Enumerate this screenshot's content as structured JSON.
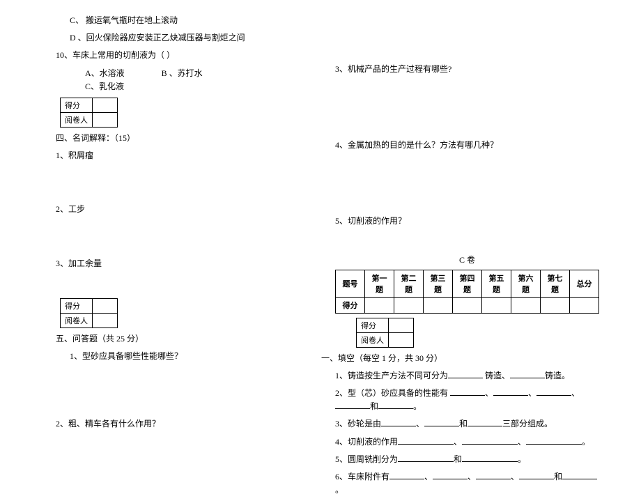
{
  "left": {
    "opt_c": "C、 搬运氧气瓶时在地上滚动",
    "opt_d": "D 、回火保险器应安装正乙炔减压器与割炬之间",
    "q10": "10、车床上常用的切削液为（        ）",
    "q10_opts": {
      "a": "A、水溶液",
      "b": "B 、苏打水",
      "c": "C、乳化液"
    },
    "mini": {
      "score": "得分",
      "marker": "阅卷人"
    },
    "sec4_title": "四、名词解释：（15）",
    "sec4_q1": "1、积屑瘤",
    "sec4_q2": "2、工步",
    "sec4_q3": "3、加工余量",
    "sec5_title": "五、问答题（共 25 分）",
    "sec5_q1": "1、型砂应具备哪些性能哪些？",
    "sec5_q2": "2、粗、精车各有什么作用？"
  },
  "right": {
    "q3": "3、机械产品的生产过程有哪些?",
    "q4": "4、金属加热的目的是什么？方法有哪几种？",
    "q5": "5、切削液的作用？",
    "paper_label": "C 卷",
    "score_header": [
      "题号",
      "第一题",
      "第二题",
      "第三题",
      "第四题",
      "第五题",
      "第六题",
      "第七题",
      "总分"
    ],
    "score_row2_label": "得分",
    "mini": {
      "score": "得分",
      "marker": "阅卷人"
    },
    "sec1_title": "一、填空（每空 1 分，共 30 分）",
    "fill": {
      "q1_a": "1、铸造按生产方法不同可分为",
      "q1_b": " 铸造、",
      "q1_c": "铸造。",
      "q2_a": "2、型（芯）砂应具备的性能有 ",
      "q2_suffix": "和",
      "q2_end": "。",
      "q3_a": "3、砂轮是由",
      "q3_b": "和",
      "q3_c": "三部分组成。",
      "q4_a": "4、切削液的作用",
      "q4_end": "。",
      "q5_a": "5、圆周铣削分为",
      "q5_b": "和",
      "q5_end": "。",
      "q6_a": "6、车床附件有",
      "q6_b": "和",
      "q6_end": "。"
    }
  }
}
